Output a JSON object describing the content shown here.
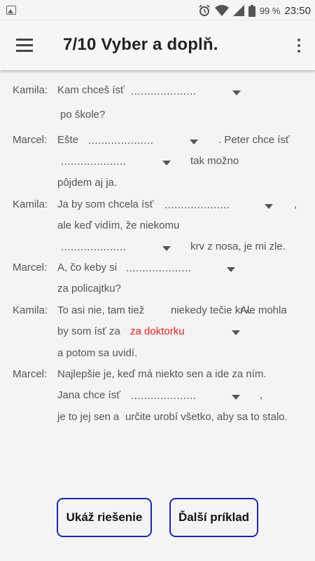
{
  "status_bar": {
    "battery": "99 %",
    "time": "23:50"
  },
  "app_bar": {
    "title": "7/10 Vyber a doplň."
  },
  "exercise": {
    "speakers": {
      "kamila": "Kamila:",
      "marcel": "Marcel:"
    },
    "blank": "....................",
    "lines": {
      "l1": "Kam chceš ísť",
      "l2": "po škole?",
      "l3": "Ešte",
      "l4": ". Peter chce ísť",
      "l5": "tak možno",
      "l6": "pôjdem aj ja.",
      "l7": "Ja by som chcela ísť",
      "l8": ",",
      "l9": "ale keď vidím, že niekomu",
      "l10": "krv z nosa, je mi zle.",
      "l11": "A, čo keby si",
      "l12": "za policajtku?",
      "l13": "To asi nie, tam tiež",
      "l14": "niekedy tečie krv.",
      "l15": "Ale mohla",
      "l16": "by som ísť za",
      "l17": "a potom sa uvidí.",
      "l18": "Najlepšie je, keď má niekto sen a ide za ním.",
      "l19": "Jana chce ísť",
      "l20": ",",
      "l21": "je to jej sen a",
      "l22": "určite urobí všetko, aby sa to stalo."
    },
    "selected_answer": "za doktorku",
    "selected_color": "#e22222"
  },
  "buttons": {
    "show_solution": "Ukáž riešenie",
    "next_example": "Ďalší príklad"
  },
  "colors": {
    "button_border": "#1b2aa3"
  }
}
